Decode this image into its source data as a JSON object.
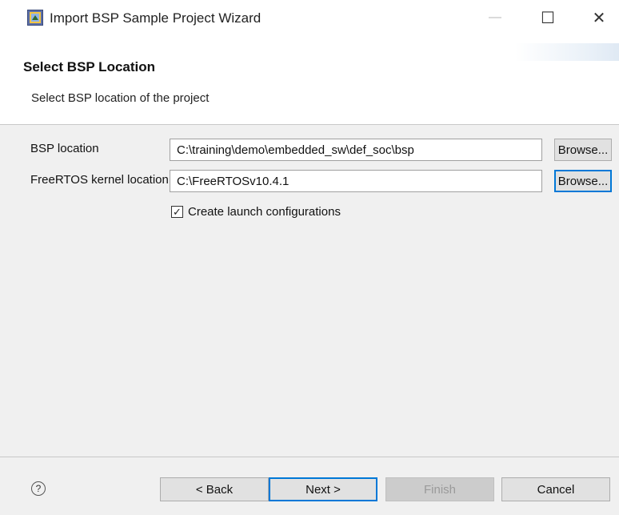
{
  "window": {
    "title": "Import BSP Sample Project Wizard",
    "controls": {
      "minimize": "—",
      "maximize": "☐",
      "close": "✕"
    }
  },
  "header": {
    "title": "Select BSP Location",
    "description": "Select BSP location of the project"
  },
  "form": {
    "bsp_location": {
      "label": "BSP location",
      "value": "C:\\training\\demo\\embedded_sw\\def_soc\\bsp",
      "browse_label": "Browse..."
    },
    "freertos_location": {
      "label": "FreeRTOS kernel location",
      "value": "C:\\FreeRTOSv10.4.1",
      "browse_label": "Browse..."
    },
    "create_launch": {
      "label": "Create launch configurations",
      "checked": true,
      "check_glyph": "✓"
    }
  },
  "footer": {
    "help_glyph": "?",
    "back_label": "< Back",
    "next_label": "Next >",
    "finish_label": "Finish",
    "cancel_label": "Cancel"
  },
  "colors": {
    "focus_accent": "#0078d7",
    "panel_background": "#f0f0f0",
    "disabled_text": "#9a9a9a"
  }
}
